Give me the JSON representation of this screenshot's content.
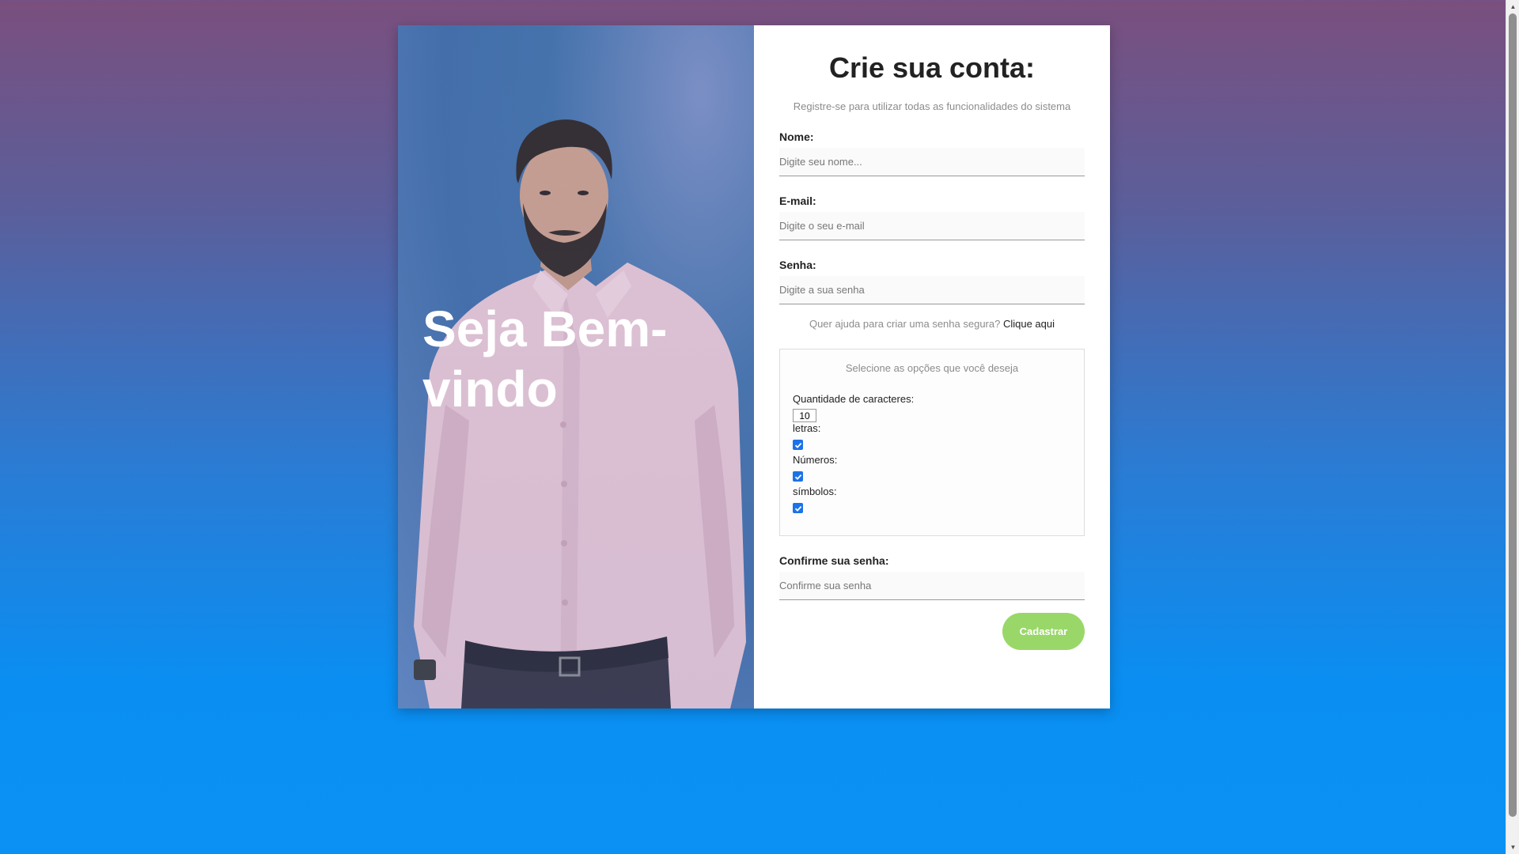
{
  "hero": {
    "welcome": "Seja Bem-vindo"
  },
  "form": {
    "title": "Crie sua conta:",
    "subtitle": "Registre-se para utilizar todas as funcionalidades do sistema",
    "name": {
      "label": "Nome:",
      "placeholder": "Digite seu nome..."
    },
    "email": {
      "label": "E-mail:",
      "placeholder": "Digite o seu e-mail"
    },
    "password": {
      "label": "Senha:",
      "placeholder": "Digite a sua senha"
    },
    "help": {
      "text": "Quer ajuda para criar uma senha segura?",
      "link": "Clique aqui"
    },
    "options": {
      "title": "Selecione as opções que você deseja",
      "quantity_label": "Quantidade de caracteres:",
      "quantity_value": "10",
      "letters_label": "letras:",
      "numbers_label": "Números:",
      "symbols_label": "símbolos:",
      "letters_checked": true,
      "numbers_checked": true,
      "symbols_checked": true
    },
    "confirm": {
      "label": "Confirme sua senha:",
      "placeholder": "Confirme sua senha"
    },
    "submit_label": "Cadastrar"
  },
  "colors": {
    "submit": "#9ad769",
    "checkbox": "#1a73e8"
  }
}
